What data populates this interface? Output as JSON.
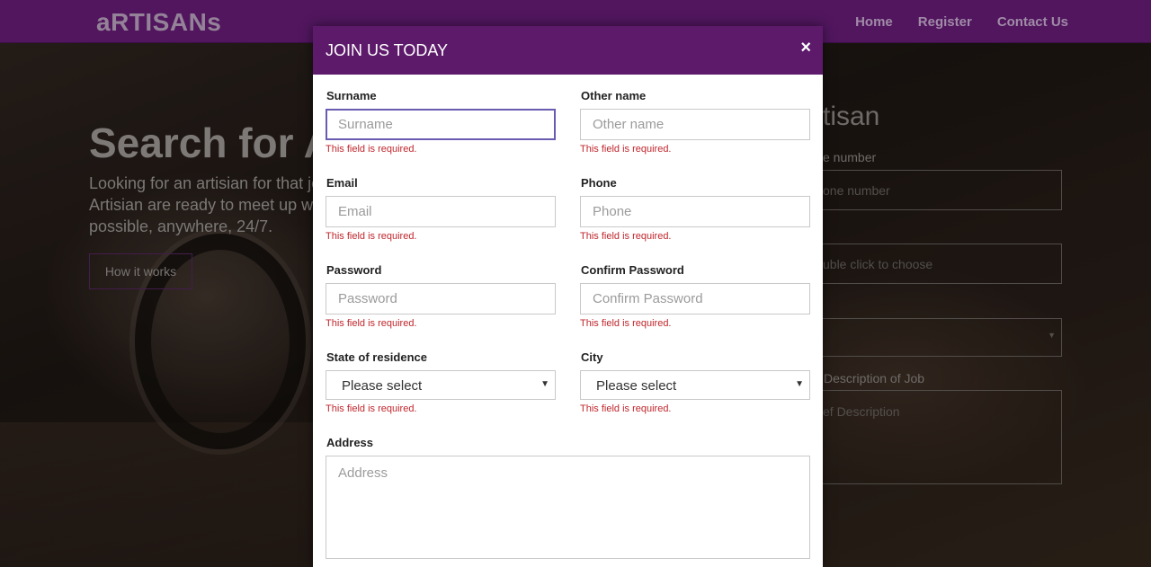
{
  "background": {
    "brand": "aRTISANs",
    "nav": [
      "Home",
      "Register",
      "Contact Us"
    ],
    "hero": {
      "title": "Search for A",
      "desc_lines": [
        "Looking for an artisian for that job",
        "Artisian are ready to meet up with",
        "possible, anywhere, 24/7."
      ],
      "button": "How it works"
    },
    "side_form": {
      "title": "tisan",
      "phone_label": "e number",
      "phone_placeholder": "one number",
      "choose_placeholder": "uble click to choose",
      "desc_label": "Description of Job",
      "desc_placeholder": "ef Description"
    }
  },
  "modal": {
    "title": "JOIN US TODAY",
    "close": "×",
    "error_text": "This field is required.",
    "fields": {
      "surname": {
        "label": "Surname",
        "placeholder": "Surname"
      },
      "othername": {
        "label": "Other name",
        "placeholder": "Other name"
      },
      "email": {
        "label": "Email",
        "placeholder": "Email"
      },
      "phone": {
        "label": "Phone",
        "placeholder": "Phone"
      },
      "password": {
        "label": "Password",
        "placeholder": "Password"
      },
      "confirm": {
        "label": "Confirm Password",
        "placeholder": "Confirm Password"
      },
      "state": {
        "label": "State of residence",
        "value": "Please select"
      },
      "city": {
        "label": "City",
        "value": "Please select"
      },
      "address": {
        "label": "Address",
        "placeholder": "Address"
      }
    }
  },
  "colors": {
    "brand_purple": "#5d1a6b",
    "error_red": "#c0262c",
    "focus_border": "#6a5bb0"
  },
  "icons": {
    "close": "close-icon",
    "select_arrow": "chevron-down-icon"
  }
}
